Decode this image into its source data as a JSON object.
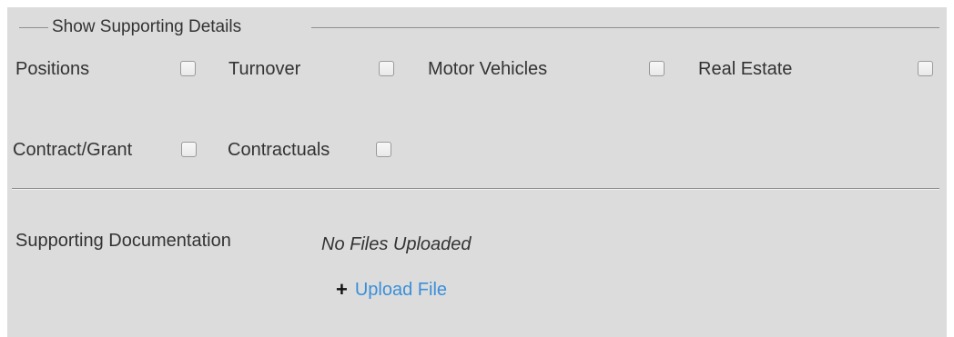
{
  "supporting_details": {
    "legend": "Show Supporting Details",
    "options": [
      {
        "label": "Positions",
        "checked": false
      },
      {
        "label": "Turnover",
        "checked": false
      },
      {
        "label": "Motor Vehicles",
        "checked": false
      },
      {
        "label": "Real Estate",
        "checked": false
      },
      {
        "label": "Contract/Grant",
        "checked": false
      },
      {
        "label": "Contractuals",
        "checked": false
      }
    ]
  },
  "documentation": {
    "label": "Supporting Documentation",
    "status": "No Files Uploaded",
    "upload_icon": "plus-icon",
    "upload_label": "Upload File"
  },
  "colors": {
    "panel_background": "#dcdcdc",
    "link": "#3a8fd9"
  }
}
